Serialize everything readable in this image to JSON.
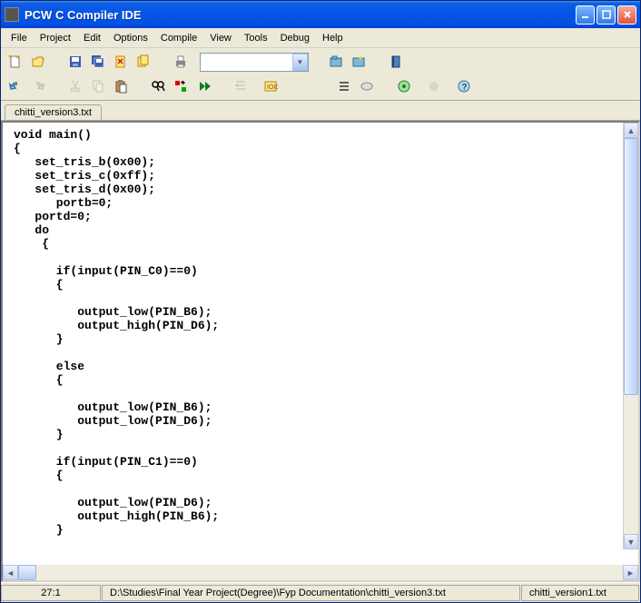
{
  "window": {
    "title": "PCW C Compiler IDE"
  },
  "menu": {
    "file": "File",
    "project": "Project",
    "edit": "Edit",
    "options": "Options",
    "compile": "Compile",
    "view": "View",
    "tools": "Tools",
    "debug": "Debug",
    "help": "Help"
  },
  "tab": {
    "name": "chitti_version3.txt"
  },
  "code": "void main()\n{\n   set_tris_b(0x00);\n   set_tris_c(0xff);\n   set_tris_d(0x00);\n      portb=0;\n   portd=0;\n   do\n    {\n\n      if(input(PIN_C0)==0)\n      {\n\n         output_low(PIN_B6);\n         output_high(PIN_D6);\n      }\n\n      else\n      {\n\n         output_low(PIN_B6);\n         output_low(PIN_D6);\n      }\n\n      if(input(PIN_C1)==0)\n      {\n\n         output_low(PIN_D6);\n         output_high(PIN_B6);\n      }",
  "status": {
    "pos": "27:1",
    "path": "D:\\Studies\\Final Year Project(Degree)\\Fyp Documentation\\chitti_version3.txt",
    "alt": "chitti_version1.txt"
  },
  "icons": {
    "new": "new",
    "open": "open",
    "save": "save",
    "saveall": "saveall",
    "print": "print",
    "undo": "undo",
    "redo": "redo",
    "find": "find",
    "help": "help"
  }
}
